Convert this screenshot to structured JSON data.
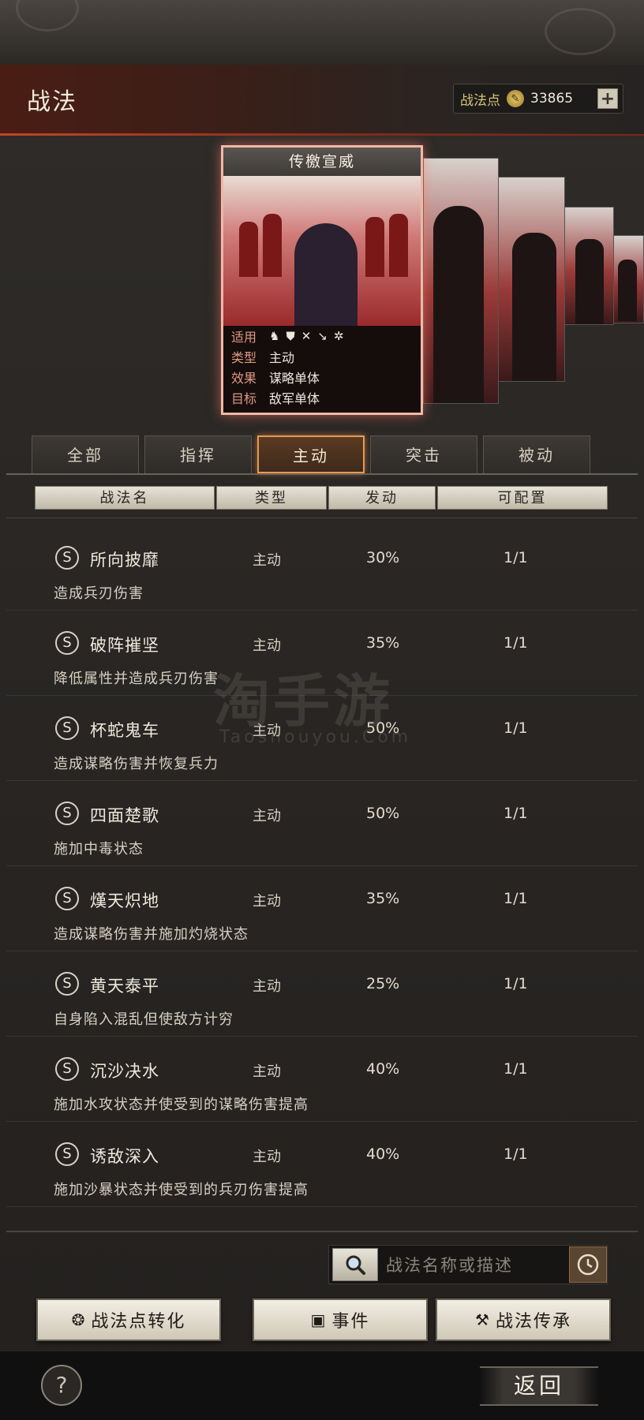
{
  "header": {
    "title": "战法",
    "points_label": "战法点",
    "points_value": "33865",
    "plus_label": "+"
  },
  "featured_card": {
    "name": "传檄宣威",
    "info": [
      {
        "key": "适用",
        "value": ""
      },
      {
        "key": "类型",
        "value": "主动"
      },
      {
        "key": "效果",
        "value": "谋略单体"
      },
      {
        "key": "目标",
        "value": "敌军单体"
      }
    ],
    "applicable_icons": [
      "cavalry-icon",
      "shield-icon",
      "bow-icon",
      "spear-icon",
      "wheel-icon"
    ]
  },
  "tabs": [
    {
      "label": "全部",
      "active": false
    },
    {
      "label": "指挥",
      "active": false
    },
    {
      "label": "主动",
      "active": true
    },
    {
      "label": "突击",
      "active": false
    },
    {
      "label": "被动",
      "active": false
    }
  ],
  "table_headers": [
    "战法名",
    "类型",
    "发动",
    "可配置"
  ],
  "rows": [
    {
      "grade": "S",
      "name": "所向披靡",
      "type": "主动",
      "rate": "30%",
      "config": "1/1",
      "desc": "造成兵刃伤害"
    },
    {
      "grade": "S",
      "name": "破阵摧坚",
      "type": "主动",
      "rate": "35%",
      "config": "1/1",
      "desc": "降低属性并造成兵刃伤害"
    },
    {
      "grade": "S",
      "name": "杯蛇鬼车",
      "type": "主动",
      "rate": "50%",
      "config": "1/1",
      "desc": "造成谋略伤害并恢复兵力"
    },
    {
      "grade": "S",
      "name": "四面楚歌",
      "type": "主动",
      "rate": "50%",
      "config": "1/1",
      "desc": "施加中毒状态"
    },
    {
      "grade": "S",
      "name": "熯天炽地",
      "type": "主动",
      "rate": "35%",
      "config": "1/1",
      "desc": "造成谋略伤害并施加灼烧状态"
    },
    {
      "grade": "S",
      "name": "黄天泰平",
      "type": "主动",
      "rate": "25%",
      "config": "1/1",
      "desc": "自身陷入混乱但使敌方计穷"
    },
    {
      "grade": "S",
      "name": "沉沙决水",
      "type": "主动",
      "rate": "40%",
      "config": "1/1",
      "desc": "施加水攻状态并使受到的谋略伤害提高"
    },
    {
      "grade": "S",
      "name": "诱敌深入",
      "type": "主动",
      "rate": "40%",
      "config": "1/1",
      "desc": "施加沙暴状态并使受到的兵刃伤害提高"
    }
  ],
  "watermark": {
    "main": "淘手游",
    "sub": "Taoshouyou.Com"
  },
  "search": {
    "placeholder": "战法名称或描述"
  },
  "buttons": {
    "convert": "战法点转化",
    "event": "事件",
    "inherit": "战法传承"
  },
  "footer": {
    "help": "?",
    "back": "返回"
  },
  "colors": {
    "accent": "#e89a50",
    "header_red": "#7a2a18",
    "card_glow": "#f0b8a8"
  }
}
